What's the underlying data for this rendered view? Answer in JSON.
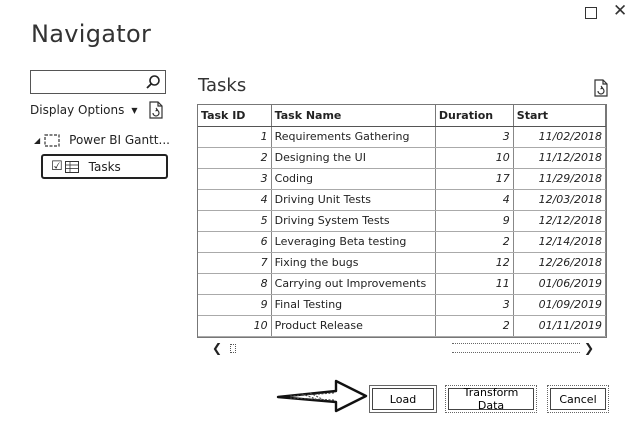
{
  "window": {
    "title": "Navigator",
    "maximize_icon": "maximize-icon",
    "close_icon": "close-icon"
  },
  "sidebar": {
    "search": {
      "value": "",
      "placeholder": ""
    },
    "display_options_label": "Display Options",
    "tree": {
      "root_label": "Power BI Gantt...",
      "child_label": "Tasks",
      "child_checked": true
    }
  },
  "preview": {
    "title": "Tasks",
    "columns": [
      "Task ID",
      "Task Name",
      "Duration",
      "Start"
    ],
    "rows": [
      {
        "id": "1",
        "name": "Requirements Gathering",
        "duration": "3",
        "start": "11/02/2018"
      },
      {
        "id": "2",
        "name": "Designing the UI",
        "duration": "10",
        "start": "11/12/2018"
      },
      {
        "id": "3",
        "name": "Coding",
        "duration": "17",
        "start": "11/29/2018"
      },
      {
        "id": "4",
        "name": "Driving Unit Tests",
        "duration": "4",
        "start": "12/03/2018"
      },
      {
        "id": "5",
        "name": "Driving System Tests",
        "duration": "9",
        "start": "12/12/2018"
      },
      {
        "id": "6",
        "name": "Leveraging Beta testing",
        "duration": "2",
        "start": "12/14/2018"
      },
      {
        "id": "7",
        "name": "Fixing the bugs",
        "duration": "12",
        "start": "12/26/2018"
      },
      {
        "id": "8",
        "name": "Carrying out Improvements",
        "duration": "11",
        "start": "01/06/2019"
      },
      {
        "id": "9",
        "name": "Final Testing",
        "duration": "3",
        "start": "01/09/2019"
      },
      {
        "id": "10",
        "name": "Product Release",
        "duration": "2",
        "start": "01/11/2019"
      }
    ]
  },
  "footer": {
    "load_label": "Load",
    "transform_label": "Transform Data",
    "cancel_label": "Cancel"
  }
}
